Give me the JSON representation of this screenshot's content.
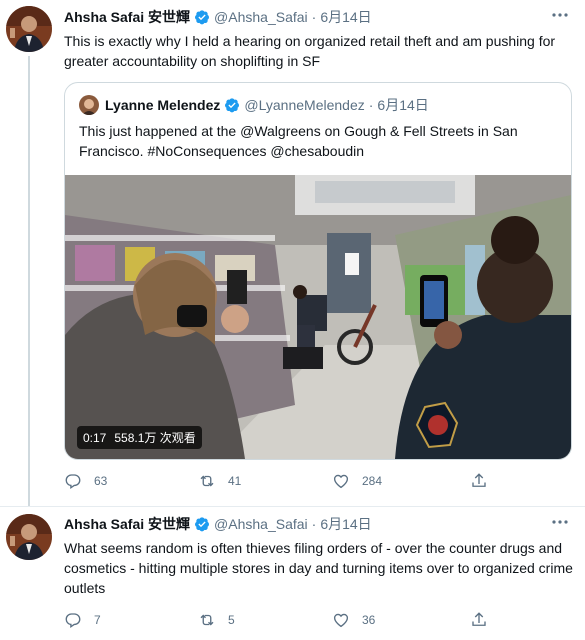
{
  "tweet1": {
    "name": "Ahsha Safai 安世輝",
    "handle": "@Ahsha_Safai",
    "dot": "·",
    "time": "6月14日",
    "text": "This is exactly why I held a hearing on organized retail theft and am pushing for greater accountability on shoplifting in SF",
    "quote": {
      "name": "Lyanne Melendez",
      "handle": "@LyanneMelendez",
      "dot": "·",
      "time": "6月14日",
      "text": "This just happened at the @Walgreens on Gough & Fell Streets in San Francisco. #NoConsequences @chesaboudin",
      "video_duration": "0:17",
      "video_views": "558.1万 次观看"
    },
    "actions": {
      "replies": "63",
      "retweets": "41",
      "likes": "284"
    }
  },
  "tweet2": {
    "name": "Ahsha Safai 安世輝",
    "handle": "@Ahsha_Safai",
    "dot": "·",
    "time": "6月14日",
    "text": "What seems random is often thieves filing orders of - over the counter drugs and cosmetics - hitting multiple stores in day and turning items over to organized crime outlets",
    "actions": {
      "replies": "7",
      "retweets": "5",
      "likes": "36"
    }
  },
  "colors": {
    "verified": "#1d9bf0",
    "muted": "#5b7083",
    "border": "#cfd9de"
  },
  "icons": [
    "verified-icon",
    "more-icon",
    "reply-icon",
    "retweet-icon",
    "like-icon",
    "share-icon"
  ]
}
